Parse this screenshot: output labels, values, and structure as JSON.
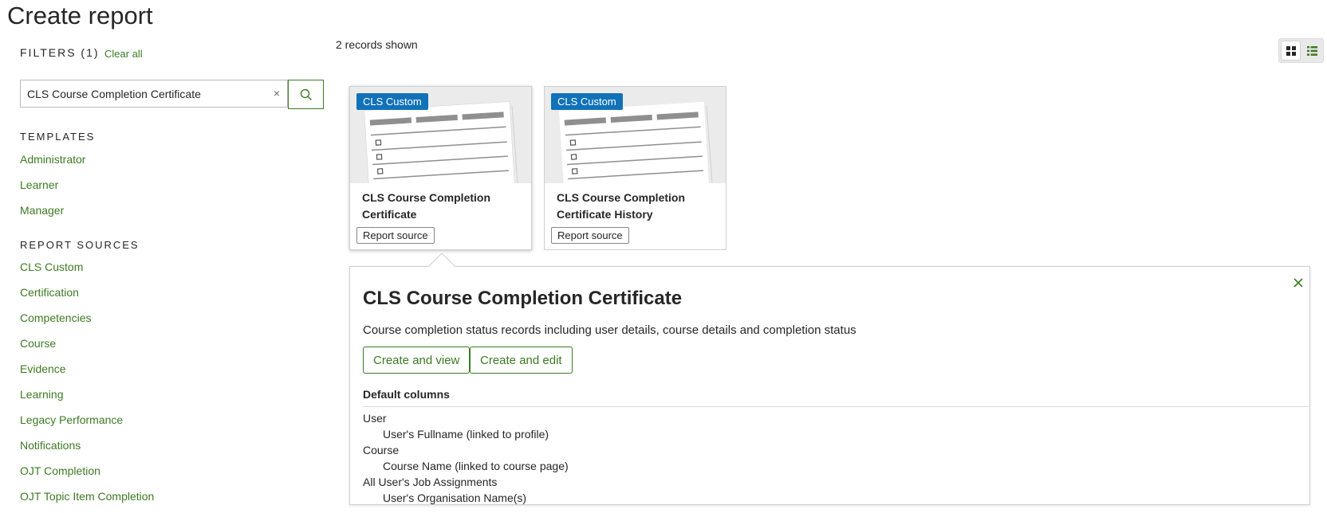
{
  "page": {
    "title": "Create report"
  },
  "sidebar": {
    "filters_label": "FILTERS (1)",
    "clear_all": "Clear all",
    "search": {
      "value": "CLS Course Completion Certificate",
      "clear": "×"
    },
    "templates_heading": "TEMPLATES",
    "templates": [
      {
        "label": "Administrator"
      },
      {
        "label": "Learner"
      },
      {
        "label": "Manager"
      }
    ],
    "sources_heading": "REPORT SOURCES",
    "sources": [
      {
        "label": "CLS Custom"
      },
      {
        "label": "Certification"
      },
      {
        "label": "Competencies"
      },
      {
        "label": "Course"
      },
      {
        "label": "Evidence"
      },
      {
        "label": "Learning"
      },
      {
        "label": "Legacy Performance"
      },
      {
        "label": "Notifications"
      },
      {
        "label": "OJT Completion"
      },
      {
        "label": "OJT Topic Item Completion"
      }
    ]
  },
  "main": {
    "records_shown": "2 records shown",
    "cards": [
      {
        "badge": "CLS Custom",
        "title": "CLS Course Completion Certificate",
        "tag": "Report source"
      },
      {
        "badge": "CLS Custom",
        "title": "CLS Course Completion Certificate History",
        "tag": "Report source"
      }
    ],
    "detail": {
      "title": "CLS Course Completion Certificate",
      "description": "Course completion status records including user details, course details and completion status",
      "create_view": "Create and view",
      "create_edit": "Create and edit",
      "columns_heading": "Default columns",
      "columns": [
        {
          "text": "User",
          "indent": false
        },
        {
          "text": "User's Fullname (linked to profile)",
          "indent": true
        },
        {
          "text": "Course",
          "indent": false
        },
        {
          "text": "Course Name (linked to course page)",
          "indent": true
        },
        {
          "text": "All User's Job Assignments",
          "indent": false
        },
        {
          "text": "User's Organisation Name(s)",
          "indent": true
        }
      ]
    }
  },
  "colors": {
    "link": "#3d7a23",
    "badge": "#1172b8"
  }
}
